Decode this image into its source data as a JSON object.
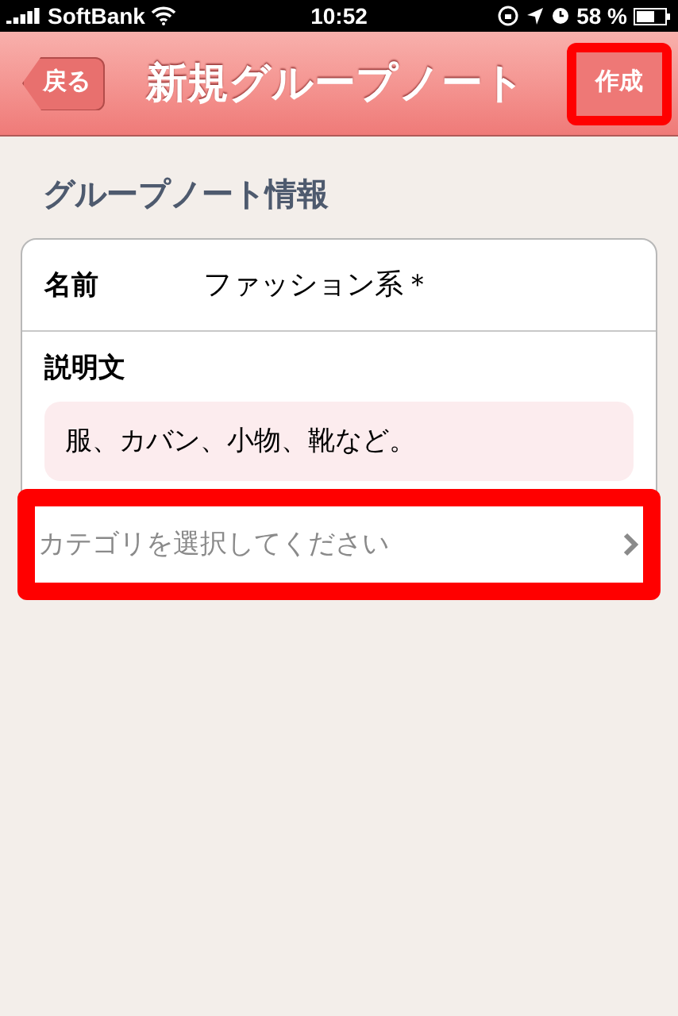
{
  "status_bar": {
    "carrier": "SoftBank",
    "time": "10:52",
    "battery": "58 %"
  },
  "nav": {
    "back": "戻る",
    "title": "新規グループノート",
    "action": {
      "label": "作成",
      "highlighted": true
    }
  },
  "section_title": "グループノート情報",
  "form": {
    "name_label": "名前",
    "name_value": "ファッション系＊",
    "description_label": "説明文",
    "description_value": "服、カバン、小物、靴など。"
  },
  "category": {
    "placeholder": "カテゴリを選択してください",
    "highlighted": true
  }
}
